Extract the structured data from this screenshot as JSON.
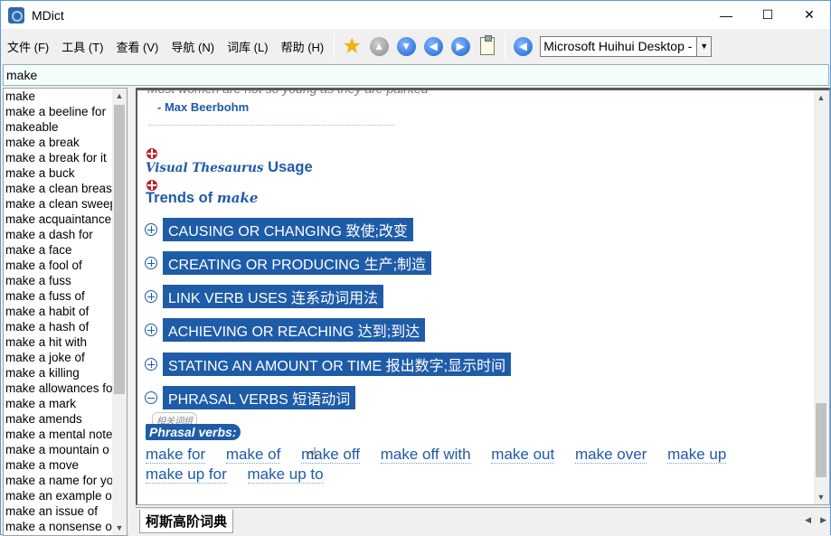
{
  "window": {
    "title": "MDict",
    "controls": [
      "—",
      "☐",
      "✕"
    ]
  },
  "menu": [
    "文件 (F)",
    "工具 (T)",
    "查看 (V)",
    "导航 (N)",
    "词库 (L)",
    "帮助 (H)"
  ],
  "toolbar": {
    "font_value": "Microsoft Huihui Desktop -"
  },
  "search": {
    "value": "make"
  },
  "wordlist": {
    "items": [
      "make",
      "make a beeline for",
      "makeable",
      "make a break",
      "make a break for it",
      "make a buck",
      "make a clean breast",
      "make a clean sweep",
      "make acquaintance",
      "make a dash for",
      "make a face",
      "make a fool of",
      "make a fuss",
      "make a fuss of",
      "make a habit of",
      "make a hash of",
      "make a hit with",
      "make a joke of",
      "make a killing",
      "make allowances for",
      "make a mark",
      "make amends",
      "make a mental note",
      "make a mountain o",
      "make a move",
      "make a name for yo",
      "make an example o",
      "make an issue of",
      "make a nonsense o"
    ]
  },
  "content": {
    "quote": "Most women are not so young as they are painted",
    "author": "- Max Beerbohm",
    "visual_thesaurus": "Visual Thesaurus",
    "usage": "Usage",
    "trends_prefix": "Trends of",
    "trends_word": "make",
    "categories": [
      {
        "label": "CAUSING OR CHANGING 致使;改变",
        "expanded": false
      },
      {
        "label": "CREATING OR PRODUCING 生产;制造",
        "expanded": false
      },
      {
        "label": "LINK VERB USES 连系动词用法",
        "expanded": false
      },
      {
        "label": "ACHIEVING OR REACHING 达到;到达",
        "expanded": false
      },
      {
        "label": "STATING AN AMOUNT OR TIME 报出数字;显示时间",
        "expanded": false
      },
      {
        "label": "PHRASAL VERBS 短语动词",
        "expanded": true
      }
    ],
    "related_tag": "相关词组",
    "phrasal_label": "Phrasal verbs:",
    "phrasal_verbs": [
      "make for",
      "make of",
      "make off",
      "make off with",
      "make out",
      "make over",
      "make up",
      "make up for",
      "make up to"
    ]
  },
  "tabs": {
    "active": "柯斯高阶词典"
  }
}
